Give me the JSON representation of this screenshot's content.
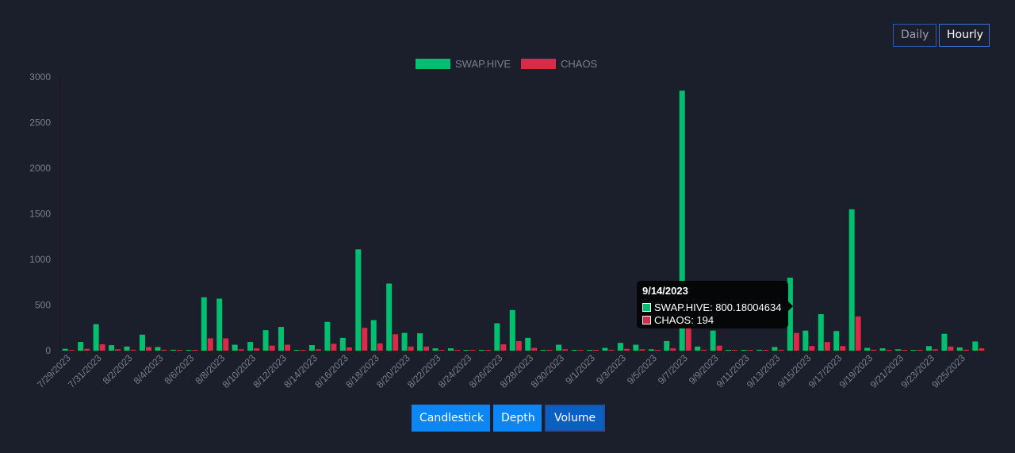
{
  "controls": {
    "daily_label": "Daily",
    "hourly_label": "Hourly"
  },
  "tabs": {
    "candlestick": "Candlestick",
    "depth": "Depth",
    "volume": "Volume"
  },
  "tooltip": {
    "date": "9/14/2023",
    "swap_text": "SWAP.HIVE: 800.18004634",
    "chaos_text": "CHAOS: 194"
  },
  "colors": {
    "swap": "#00c070",
    "chaos": "#d92a4a",
    "background": "#1b1f2c"
  },
  "chart_data": {
    "type": "bar",
    "legend_position": "top-center",
    "grid": false,
    "ylim": [
      0,
      3000
    ],
    "yticks": [
      0,
      500,
      1000,
      1500,
      2000,
      2500,
      3000
    ],
    "categories": [
      "7/29/2023",
      "7/30/2023",
      "7/31/2023",
      "8/1/2023",
      "8/2/2023",
      "8/3/2023",
      "8/4/2023",
      "8/5/2023",
      "8/6/2023",
      "8/7/2023",
      "8/8/2023",
      "8/9/2023",
      "8/10/2023",
      "8/11/2023",
      "8/12/2023",
      "8/13/2023",
      "8/14/2023",
      "8/15/2023",
      "8/16/2023",
      "8/17/2023",
      "8/18/2023",
      "8/19/2023",
      "8/20/2023",
      "8/21/2023",
      "8/22/2023",
      "8/23/2023",
      "8/24/2023",
      "8/25/2023",
      "8/26/2023",
      "8/27/2023",
      "8/28/2023",
      "8/29/2023",
      "8/30/2023",
      "8/31/2023",
      "9/1/2023",
      "9/2/2023",
      "9/3/2023",
      "9/4/2023",
      "9/5/2023",
      "9/6/2023",
      "9/7/2023",
      "9/8/2023",
      "9/9/2023",
      "9/10/2023",
      "9/11/2023",
      "9/12/2023",
      "9/13/2023",
      "9/14/2023",
      "9/15/2023",
      "9/16/2023",
      "9/17/2023",
      "9/18/2023",
      "9/19/2023",
      "9/20/2023",
      "9/21/2023",
      "9/22/2023",
      "9/23/2023",
      "9/24/2023",
      "9/25/2023",
      "9/26/2023"
    ],
    "xtick_labels": [
      "7/29/2023",
      "7/31/2023",
      "8/2/2023",
      "8/4/2023",
      "8/6/2023",
      "8/8/2023",
      "8/10/2023",
      "8/12/2023",
      "8/14/2023",
      "8/16/2023",
      "8/18/2023",
      "8/20/2023",
      "8/22/2023",
      "8/24/2023",
      "8/26/2023",
      "8/28/2023",
      "8/30/2023",
      "9/1/2023",
      "9/3/2023",
      "9/5/2023",
      "9/7/2023",
      "9/9/2023",
      "9/11/2023",
      "9/13/2023",
      "9/15/2023",
      "9/17/2023",
      "9/19/2023",
      "9/21/2023",
      "9/23/2023",
      "9/25/2023"
    ],
    "series": [
      {
        "name": "SWAP.HIVE",
        "values": [
          20,
          95,
          290,
          60,
          45,
          175,
          40,
          10,
          5,
          585,
          570,
          65,
          95,
          225,
          260,
          5,
          60,
          315,
          140,
          1110,
          335,
          735,
          195,
          190,
          25,
          25,
          5,
          5,
          300,
          445,
          140,
          5,
          65,
          5,
          5,
          30,
          85,
          65,
          15,
          105,
          2850,
          45,
          220,
          5,
          5,
          10,
          40,
          800.18,
          220,
          400,
          215,
          1550,
          30,
          25,
          15,
          5,
          50,
          185,
          35,
          100
        ]
      },
      {
        "name": "CHAOS",
        "values": [
          5,
          20,
          70,
          15,
          10,
          40,
          10,
          2,
          2,
          135,
          135,
          15,
          25,
          55,
          65,
          2,
          15,
          75,
          35,
          250,
          80,
          180,
          45,
          45,
          5,
          5,
          2,
          2,
          70,
          105,
          30,
          2,
          15,
          2,
          2,
          10,
          20,
          15,
          5,
          25,
          660,
          10,
          55,
          2,
          2,
          2,
          10,
          194,
          50,
          95,
          50,
          375,
          10,
          5,
          5,
          2,
          15,
          45,
          10,
          25
        ]
      }
    ]
  }
}
